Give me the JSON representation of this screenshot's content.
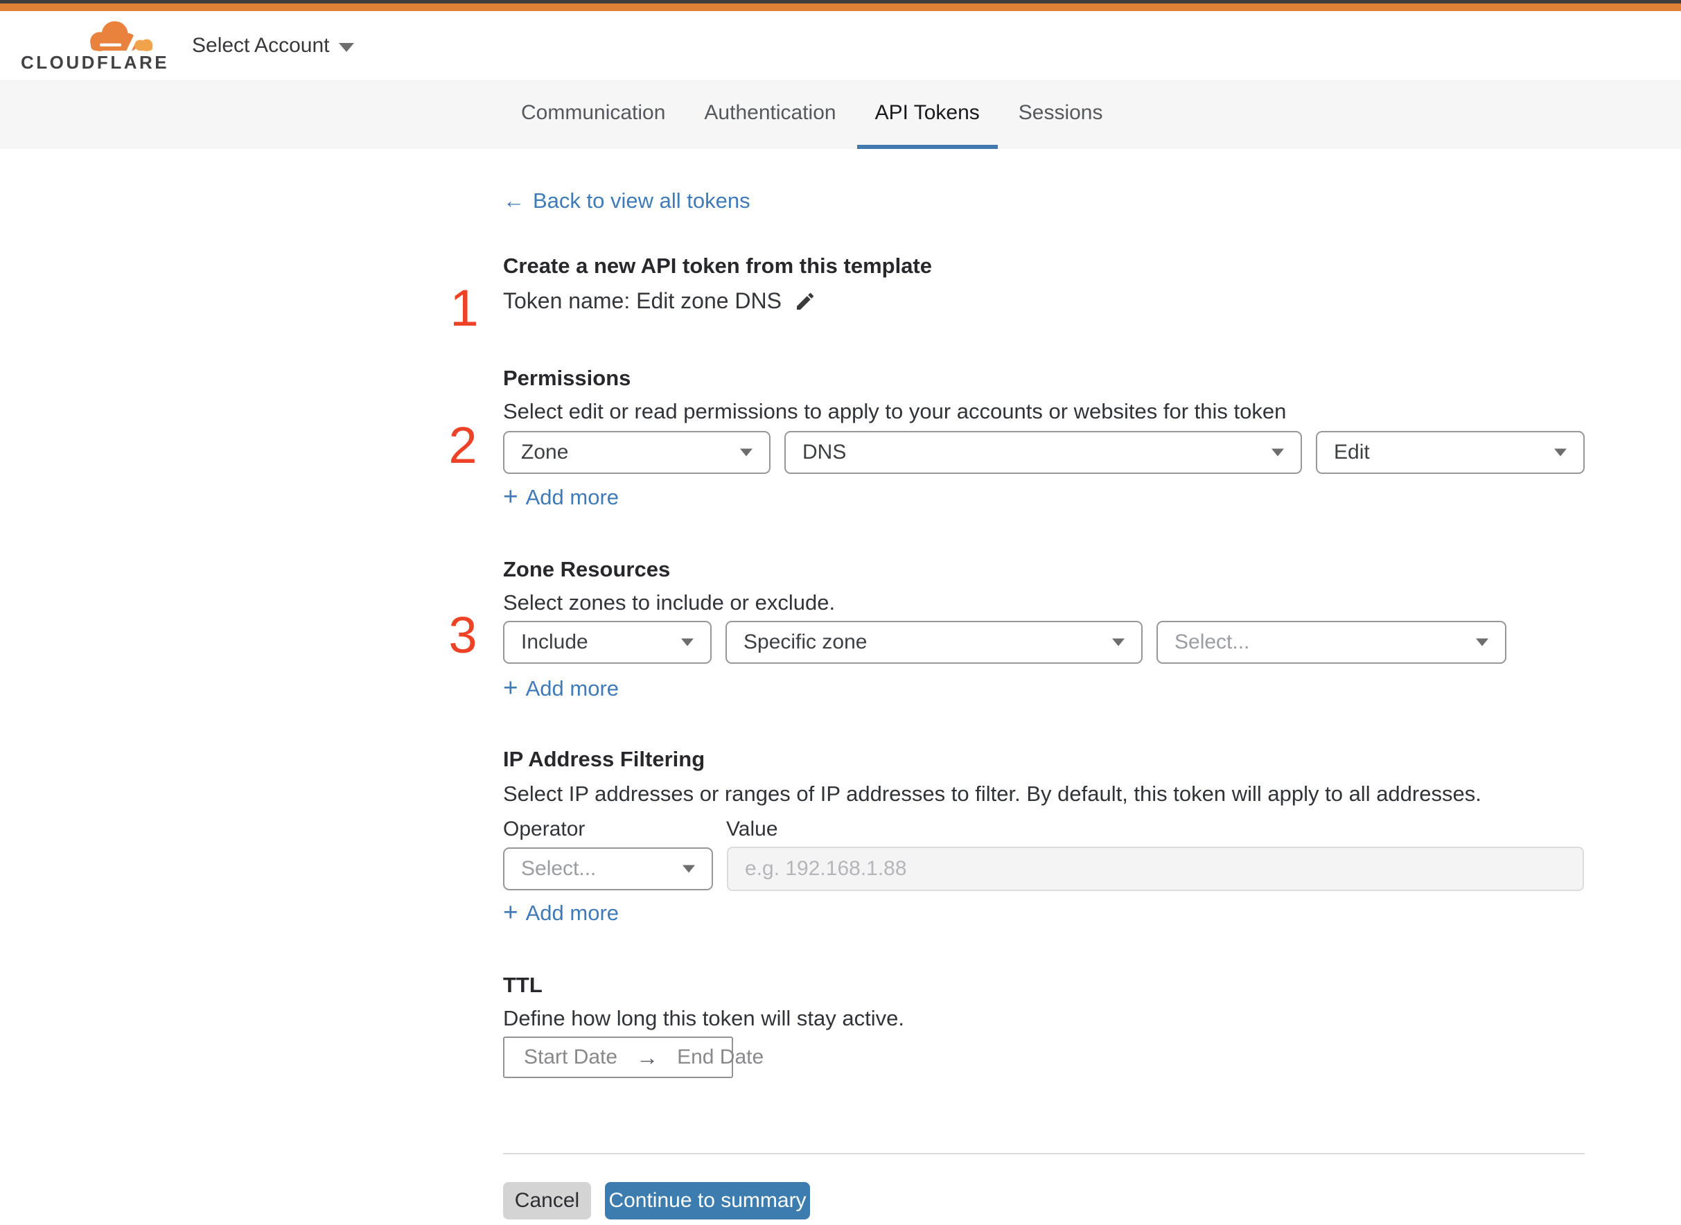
{
  "header": {
    "logo_text": "CLOUDFLARE",
    "account_selector_label": "Select Account"
  },
  "tabs": [
    {
      "label": "Communication",
      "active": false
    },
    {
      "label": "Authentication",
      "active": false
    },
    {
      "label": "API Tokens",
      "active": true
    },
    {
      "label": "Sessions",
      "active": false
    }
  ],
  "back_link": {
    "arrow": "←",
    "label": "Back to view all tokens"
  },
  "steps": [
    "1",
    "2",
    "3"
  ],
  "template_section": {
    "heading": "Create a new API token from this template",
    "token_name": "Token name: Edit zone DNS"
  },
  "permissions": {
    "title": "Permissions",
    "subtitle": "Select edit or read permissions to apply to your accounts or websites for this token",
    "selects": [
      {
        "value": "Zone"
      },
      {
        "value": "DNS"
      },
      {
        "value": "Edit"
      }
    ],
    "add_more": "Add more"
  },
  "zone_resources": {
    "title": "Zone Resources",
    "subtitle": "Select zones to include or exclude.",
    "selects": [
      {
        "value": "Include"
      },
      {
        "value": "Specific zone"
      },
      {
        "value": "Select..."
      }
    ],
    "add_more": "Add more"
  },
  "ip_filtering": {
    "title": "IP Address Filtering",
    "subtitle": "Select IP addresses or ranges of IP addresses to filter. By default, this token will apply to all addresses.",
    "operator_label": "Operator",
    "value_label": "Value",
    "operator_select": "Select...",
    "value_placeholder": "e.g. 192.168.1.88",
    "add_more": "Add more"
  },
  "ttl": {
    "title": "TTL",
    "subtitle": "Define how long this token will stay active.",
    "start_placeholder": "Start Date",
    "arrow": "→",
    "end_placeholder": "End Date"
  },
  "footer": {
    "cancel_label": "Cancel",
    "continue_label": "Continue to summary"
  },
  "icons": {
    "plus": "+"
  },
  "colors": {
    "brand_orange": "#e08138",
    "topbar_dark": "#3e3d3e",
    "accent_blue": "#3e7bb8",
    "active_tab_underline": "#4379ad",
    "continue_button": "#3d7cae",
    "step_marker_red": "#ee4227",
    "tabbar_background": "#f6f6f7"
  }
}
